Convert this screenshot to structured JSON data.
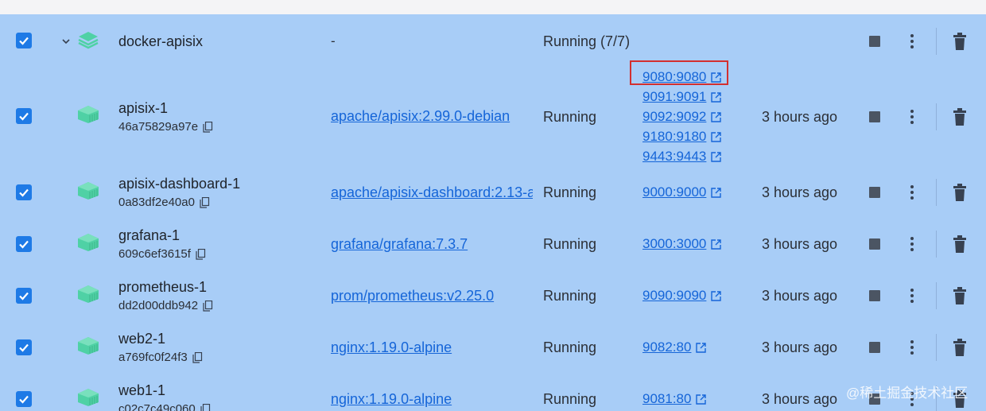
{
  "group": {
    "name": "docker-apisix",
    "image": "-",
    "status": "Running (7/7)"
  },
  "containers": [
    {
      "name": "apisix-1",
      "id": "46a75829a97e",
      "image": "apache/apisix:2.99.0-debian",
      "status": "Running",
      "ports": [
        "9080:9080",
        "9091:9091",
        "9092:9092",
        "9180:9180",
        "9443:9443"
      ],
      "started": "3 hours ago"
    },
    {
      "name": "apisix-dashboard-1",
      "id": "0a83df2e40a0",
      "image": "apache/apisix-dashboard:2.13-a",
      "status": "Running",
      "ports": [
        "9000:9000"
      ],
      "started": "3 hours ago"
    },
    {
      "name": "grafana-1",
      "id": "609c6ef3615f",
      "image": "grafana/grafana:7.3.7",
      "status": "Running",
      "ports": [
        "3000:3000"
      ],
      "started": "3 hours ago"
    },
    {
      "name": "prometheus-1",
      "id": "dd2d00ddb942",
      "image": "prom/prometheus:v2.25.0",
      "status": "Running",
      "ports": [
        "9090:9090"
      ],
      "started": "3 hours ago"
    },
    {
      "name": "web2-1",
      "id": "a769fc0f24f3",
      "image": "nginx:1.19.0-alpine",
      "status": "Running",
      "ports": [
        "9082:80"
      ],
      "started": "3 hours ago"
    },
    {
      "name": "web1-1",
      "id": "c02c7c49c060",
      "image": "nginx:1.19.0-alpine",
      "status": "Running",
      "ports": [
        "9081:80"
      ],
      "started": "3 hours ago"
    }
  ],
  "watermark": "@稀土掘金技术社区",
  "colors": {
    "selected_row": "#a8cdf7",
    "checkbox": "#1e7ae6",
    "link": "#1565d8",
    "container_icon": "#4fd1a5",
    "highlight_box": "#d32f2f"
  },
  "icons": {
    "checkbox": "checkmark-icon",
    "group": "stack-icon",
    "container": "container-icon",
    "copy": "copy-icon",
    "port_link": "external-link-icon",
    "stop": "stop-icon",
    "more": "more-vertical-icon",
    "delete": "trash-icon"
  }
}
